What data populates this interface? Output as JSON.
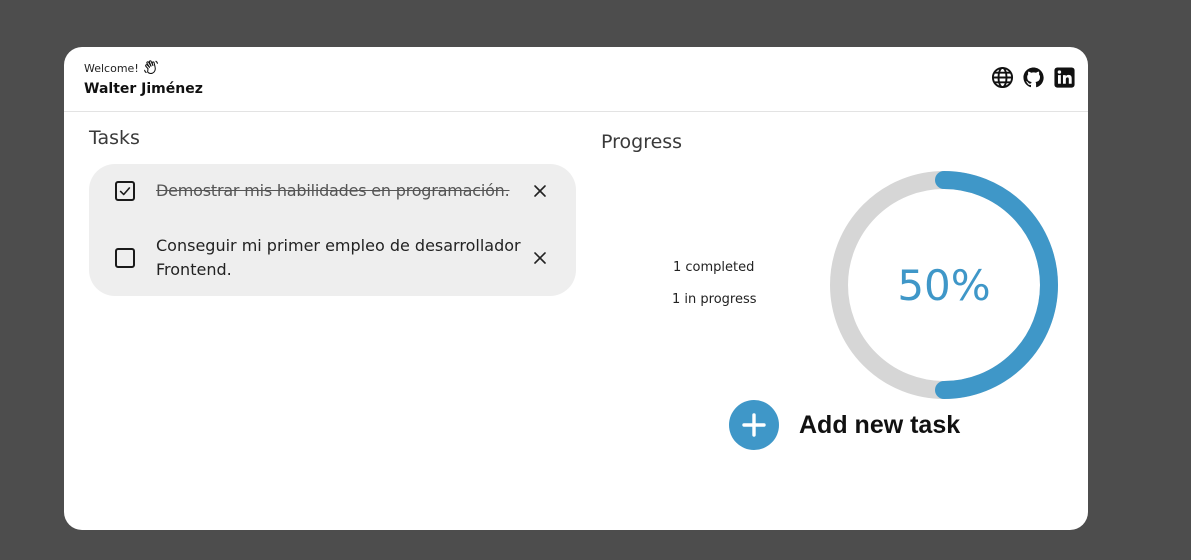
{
  "header": {
    "welcome": "Welcome!",
    "user_name": "Walter Jiménez",
    "icons": [
      "globe-icon",
      "github-icon",
      "linkedin-icon"
    ]
  },
  "tasks": {
    "title": "Tasks",
    "items": [
      {
        "text": "Demostrar mis habilidades en programación.",
        "completed": true
      },
      {
        "text": "Conseguir mi primer empleo de desarrollador Frontend.",
        "completed": false
      }
    ]
  },
  "progress": {
    "title": "Progress",
    "completed_text": "1 completed",
    "in_progress_text": "1 in progress",
    "percent_label": "50%",
    "percent": 50
  },
  "add_task": {
    "label": "Add new task"
  },
  "colors": {
    "accent": "#3f97c8",
    "track": "#d6d6d6",
    "task_bg": "#eeeeee",
    "backdrop": "#4d4d4d"
  }
}
